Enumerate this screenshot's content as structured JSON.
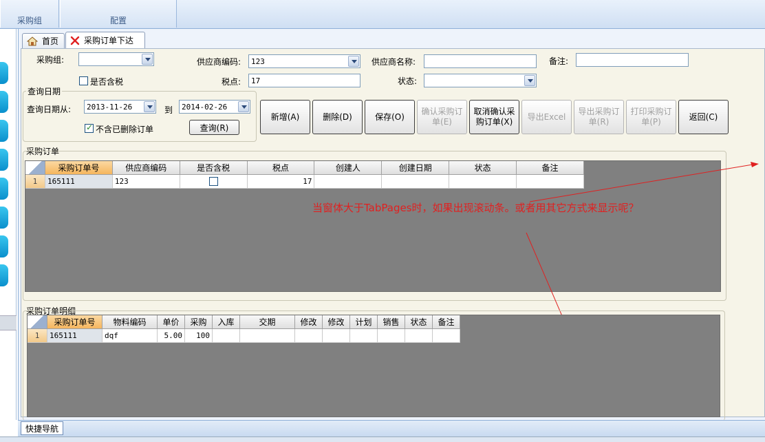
{
  "ribbon": {
    "groups": [
      {
        "label": "采购组"
      },
      {
        "label": "配置"
      }
    ]
  },
  "tabs": [
    {
      "label": "首页",
      "icon": "home-icon"
    },
    {
      "label": "采购订单下达",
      "icon": "close-icon"
    }
  ],
  "filters": {
    "purchase_group_label": "采购组:",
    "purchase_group_value": "",
    "supplier_code_label": "供应商编码:",
    "supplier_code_value": "123",
    "supplier_name_label": "供应商名称:",
    "supplier_name_value": "",
    "remark_label": "备注:",
    "remark_value": "",
    "tax_included_label": "是否含税",
    "tax_included_checked": false,
    "tax_rate_label": "税点:",
    "tax_rate_value": "17",
    "status_label": "状态:",
    "status_value": ""
  },
  "query_date": {
    "group_title": "查询日期",
    "from_label": "查询日期从:",
    "from_value": "2013-11-26",
    "to_label": "到",
    "to_value": "2014-02-26",
    "exclude_deleted_label": "不含已删除订单",
    "exclude_deleted_checked": true,
    "query_button": "查询(R)"
  },
  "actions": [
    {
      "label": "新增(A)",
      "enabled": true
    },
    {
      "label": "删除(D)",
      "enabled": true
    },
    {
      "label": "保存(O)",
      "enabled": true
    },
    {
      "label": "确认采购订单(E)",
      "enabled": false
    },
    {
      "label": "取消确认采购订单(X)",
      "enabled": true
    },
    {
      "label": "导出Excel",
      "enabled": false
    },
    {
      "label": "导出采购订单(R)",
      "enabled": false
    },
    {
      "label": "打印采购订单(P)",
      "enabled": false
    },
    {
      "label": "返回(C)",
      "enabled": true
    }
  ],
  "orders": {
    "title": "采购订单",
    "columns": [
      "采购订单号",
      "供应商编码",
      "是否含税",
      "税点",
      "创建人",
      "创建日期",
      "状态",
      "备注"
    ],
    "rows": [
      {
        "row_no": "1",
        "order_no": "165111",
        "supplier_code": "123",
        "tax_included": false,
        "tax_rate": "17",
        "creator": "",
        "created": "",
        "status": "",
        "remark": ""
      }
    ]
  },
  "annotation": "当窗体大于TabPages时，如果出现滚动条。或者用其它方式来显示呢？",
  "details": {
    "title": "采购订单明细",
    "columns": [
      "采购订单号",
      "物料编码",
      "单价",
      "采购",
      "入库",
      "交期",
      "修改",
      "修改",
      "计划",
      "销售",
      "状态",
      "备注"
    ],
    "rows": [
      {
        "row_no": "1",
        "order_no": "165111",
        "material": "dqf",
        "price": "5.00",
        "qty": "100"
      }
    ]
  },
  "bottom": {
    "quick_nav": "快捷导航"
  },
  "colors": {
    "accent_blue": "#0a8fcc",
    "annotation_red": "#e02020",
    "grid_gray": "#808080"
  }
}
